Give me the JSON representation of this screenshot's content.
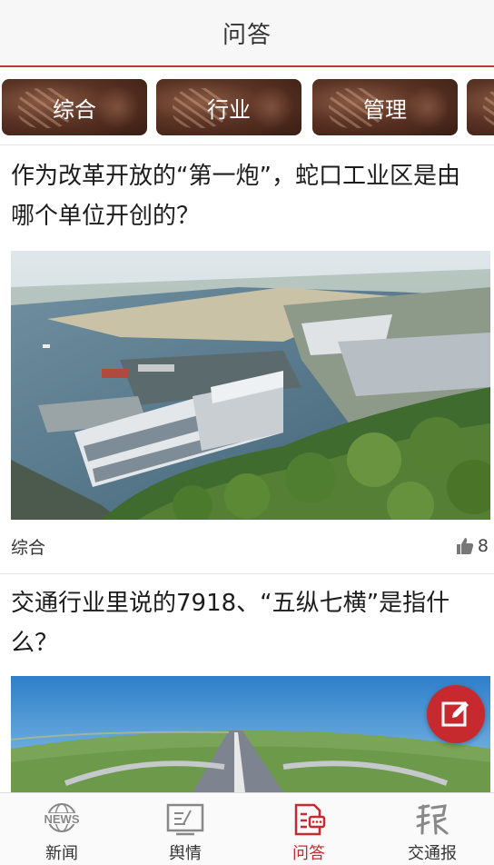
{
  "header": {
    "title": "问答"
  },
  "categories": [
    {
      "label": "综合"
    },
    {
      "label": "行业"
    },
    {
      "label": "管理"
    },
    {
      "label": ""
    }
  ],
  "articles": [
    {
      "title": "作为改革开放的“第一炮”，蛇口工业区是由哪个单位开创的？",
      "category": "综合",
      "likes": "8"
    },
    {
      "title": "交通行业里说的7918、“五纵七横”是指什么？"
    }
  ],
  "tabbar": {
    "items": [
      {
        "label": "新闻",
        "icon": "news-icon",
        "active": false
      },
      {
        "label": "舆情",
        "icon": "monitor-icon",
        "active": false
      },
      {
        "label": "问答",
        "icon": "qa-icon",
        "active": true
      },
      {
        "label": "交通报",
        "icon": "newspaper-icon",
        "active": false
      }
    ]
  },
  "colors": {
    "accent": "#c62a2f",
    "header_bg": "#f7f7f7"
  }
}
